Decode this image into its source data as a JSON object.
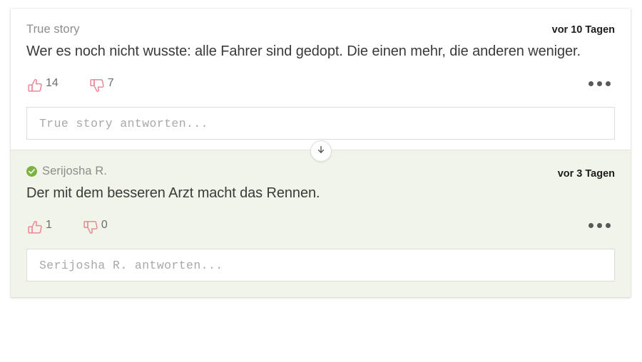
{
  "colors": {
    "vote_icon": "#e8889a",
    "verified_green": "#7cb342",
    "comment_green_bg": "#f1f4e9",
    "card_bg": "#ffffff",
    "body_text": "#3a3a3a",
    "author_text": "#8c8c8c"
  },
  "comments": [
    {
      "author": "True story",
      "verified": false,
      "timestamp": "vor 10 Tagen",
      "text": "Wer es noch nicht wusste: alle Fahrer sind gedopt. Die einen mehr, die anderen weniger.",
      "upvotes": "14",
      "downvotes": "7",
      "reply_placeholder": "True story antworten...",
      "more_label": "..."
    },
    {
      "author": "Serijosha R.",
      "verified": true,
      "timestamp": "vor 3 Tagen",
      "text": "Der mit dem besseren Arzt macht das Rennen.",
      "upvotes": "1",
      "downvotes": "0",
      "reply_placeholder": "Serijosha R. antworten...",
      "more_label": "..."
    }
  ],
  "divider": {
    "icon": "arrow-down-icon"
  },
  "icons": {
    "thumbs_up": "thumbs-up-icon",
    "thumbs_down": "thumbs-down-icon",
    "more": "more-options-icon",
    "verified": "verified-check-icon"
  }
}
